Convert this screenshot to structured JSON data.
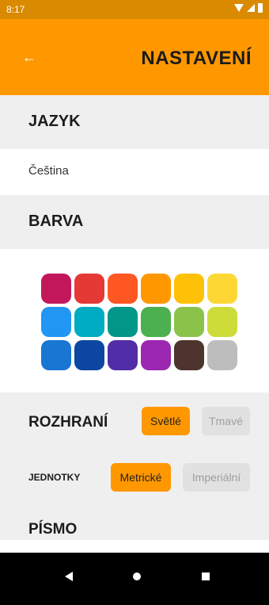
{
  "status_bar": {
    "time": "8:17"
  },
  "header": {
    "title": "NASTAVENÍ",
    "back_icon": "←"
  },
  "language": {
    "title": "JAZYK",
    "value": "Čeština"
  },
  "color": {
    "title": "BARVA",
    "swatches": [
      "#C2185B",
      "#E53935",
      "#FF5722",
      "#FF9800",
      "#FFC107",
      "#FDD835",
      "#2196F3",
      "#00ACC1",
      "#009688",
      "#4CAF50",
      "#8BC34A",
      "#CDDC39",
      "#1976D2",
      "#0D47A1",
      "#512DA8",
      "#9C27B0",
      "#4E342E",
      "#BDBDBD"
    ]
  },
  "interface": {
    "title": "ROZHRANÍ",
    "options": [
      "Světlé",
      "Tmavé"
    ],
    "selected": "Světlé"
  },
  "units": {
    "title": "JEDNOTKY",
    "options": [
      "Metrické",
      "Imperiální"
    ],
    "selected": "Metrické"
  },
  "font": {
    "title": "PÍSMO"
  },
  "colors": {
    "accent": "#FF9800",
    "status_bar": "#D98A00",
    "section_bg": "#EFEFEF"
  }
}
